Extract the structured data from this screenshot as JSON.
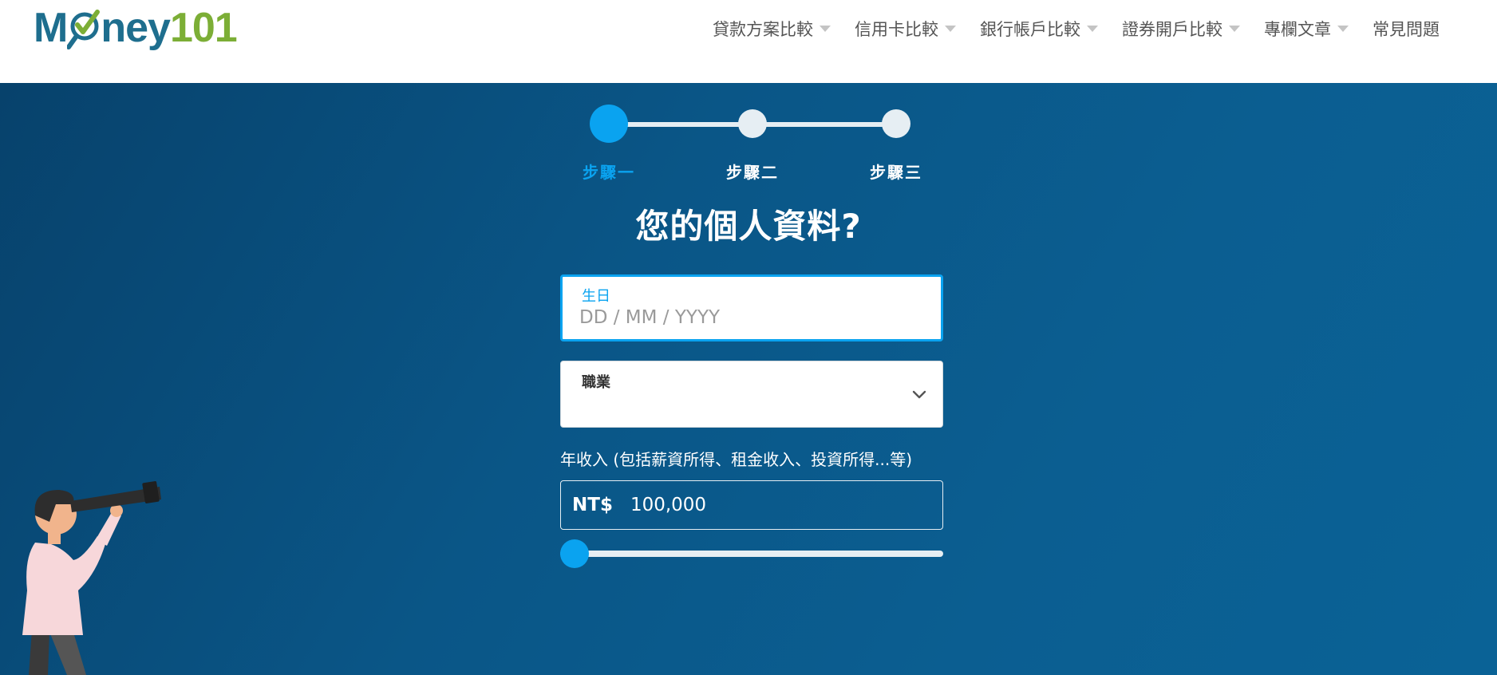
{
  "header": {
    "logo": {
      "text_m": "M",
      "text_rest": "ney",
      "text_num": "101",
      "icon": "magnifier-check-icon"
    },
    "nav": [
      {
        "label": "貸款方案比較",
        "has_dropdown": true
      },
      {
        "label": "信用卡比較",
        "has_dropdown": true
      },
      {
        "label": "銀行帳戶比較",
        "has_dropdown": true
      },
      {
        "label": "證券開戶比較",
        "has_dropdown": true
      },
      {
        "label": "專欄文章",
        "has_dropdown": true
      },
      {
        "label": "常見問題",
        "has_dropdown": false
      }
    ]
  },
  "stepper": {
    "steps": [
      {
        "label": "步驟一",
        "active": true
      },
      {
        "label": "步驟二",
        "active": false
      },
      {
        "label": "步驟三",
        "active": false
      }
    ]
  },
  "form": {
    "title": "您的個人資料?",
    "birthday": {
      "label": "生日",
      "value": "",
      "placeholder": "DD / MM / YYYY"
    },
    "occupation": {
      "label": "職業",
      "value": "",
      "icon": "chevron-down-icon"
    },
    "income": {
      "label": "年收入 (包括薪資所得、租金收入、投資所得...等)",
      "currency": "NT$",
      "value": "100,000",
      "slider_fraction": 0.03
    }
  },
  "colors": {
    "accent": "#0aa3f0",
    "brand_blue": "#1e6e8e",
    "brand_green": "#7cae36",
    "hero_dark": "#07426c",
    "hero_light": "#0a6296",
    "inactive_step": "#e6eef3"
  }
}
